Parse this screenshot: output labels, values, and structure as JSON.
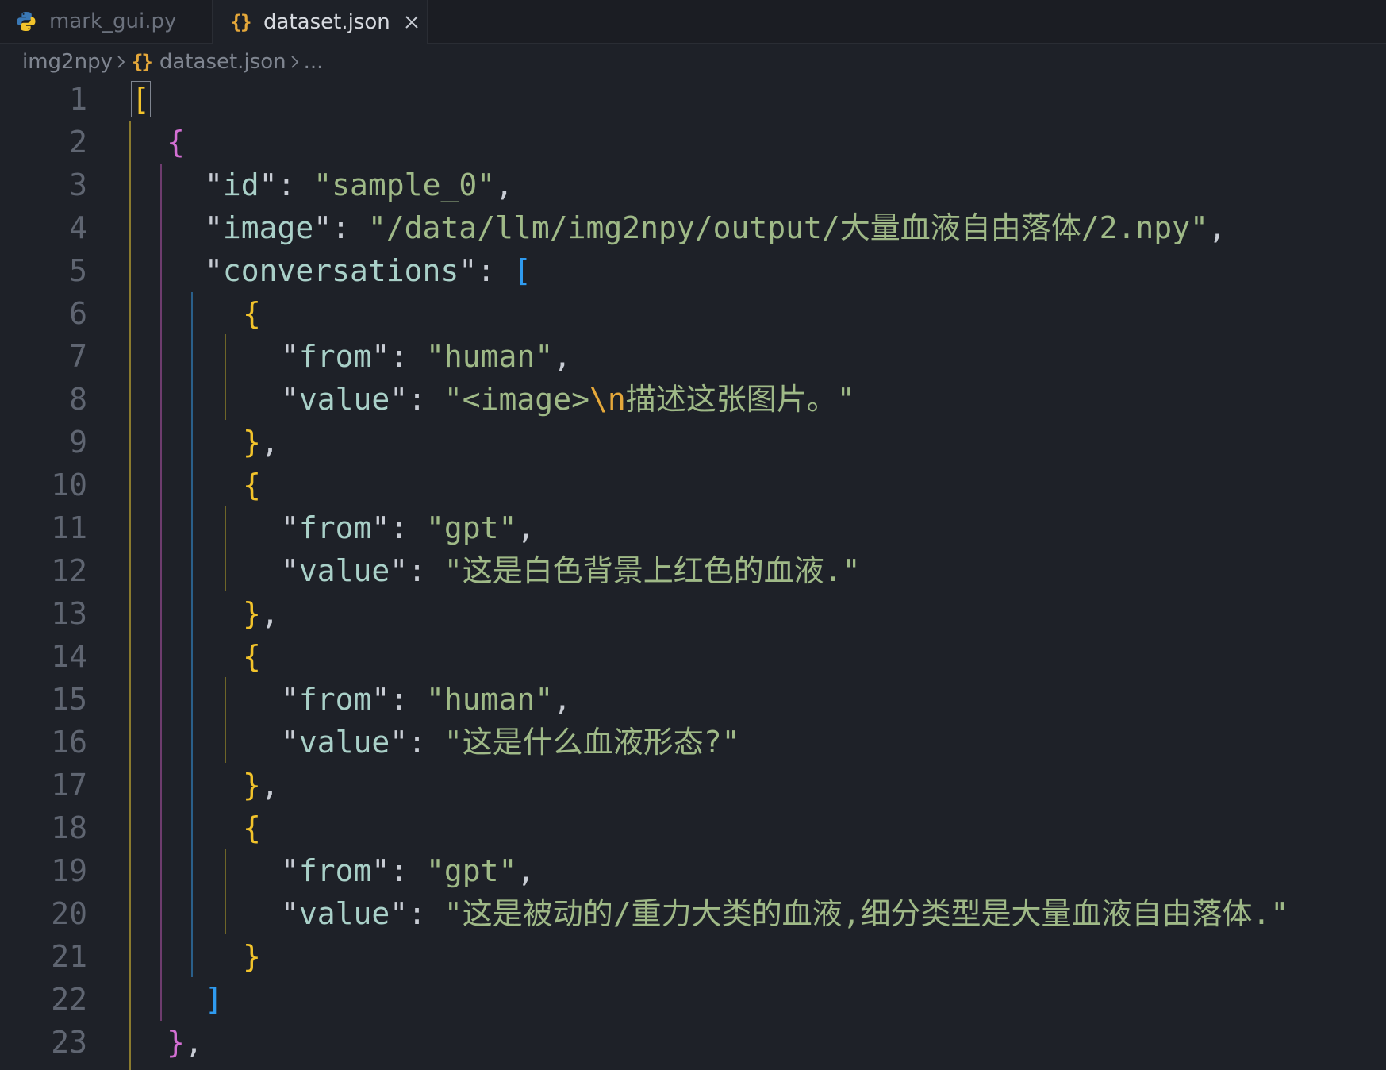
{
  "tabs": [
    {
      "label": "mark_gui.py",
      "icon": "python-file-icon",
      "active": false
    },
    {
      "label": "dataset.json",
      "icon": "json-braces-icon",
      "active": true
    }
  ],
  "breadcrumb": {
    "folder": "img2npy",
    "file": "dataset.json",
    "more": "..."
  },
  "editor": {
    "line_numbers": [
      "1",
      "2",
      "3",
      "4",
      "5",
      "6",
      "7",
      "8",
      "9",
      "10",
      "11",
      "12",
      "13",
      "14",
      "15",
      "16",
      "17",
      "18",
      "19",
      "20",
      "21",
      "22",
      "23"
    ],
    "lines": [
      [
        {
          "t": "b1",
          "v": "["
        }
      ],
      [
        {
          "t": "b2",
          "v": "{"
        }
      ],
      [
        {
          "t": "p",
          "v": "\""
        },
        {
          "t": "k",
          "v": "id"
        },
        {
          "t": "p",
          "v": "\": "
        },
        {
          "t": "s",
          "v": "\"sample_0\""
        },
        {
          "t": "p",
          "v": ","
        }
      ],
      [
        {
          "t": "p",
          "v": "\""
        },
        {
          "t": "k",
          "v": "image"
        },
        {
          "t": "p",
          "v": "\": "
        },
        {
          "t": "s",
          "v": "\"/data/llm/img2npy/output/大量血液自由落体/2.npy\""
        },
        {
          "t": "p",
          "v": ","
        }
      ],
      [
        {
          "t": "p",
          "v": "\""
        },
        {
          "t": "k",
          "v": "conversations"
        },
        {
          "t": "p",
          "v": "\": "
        },
        {
          "t": "b3",
          "v": "["
        }
      ],
      [
        {
          "t": "b1",
          "v": "{"
        }
      ],
      [
        {
          "t": "p",
          "v": "\""
        },
        {
          "t": "k",
          "v": "from"
        },
        {
          "t": "p",
          "v": "\": "
        },
        {
          "t": "s",
          "v": "\"human\""
        },
        {
          "t": "p",
          "v": ","
        }
      ],
      [
        {
          "t": "p",
          "v": "\""
        },
        {
          "t": "k",
          "v": "value"
        },
        {
          "t": "p",
          "v": "\": "
        },
        {
          "t": "s",
          "v": "\"<image>"
        },
        {
          "t": "esc",
          "v": "\\n"
        },
        {
          "t": "s",
          "v": "描述这张图片。\""
        }
      ],
      [
        {
          "t": "b1",
          "v": "}"
        },
        {
          "t": "p",
          "v": ","
        }
      ],
      [
        {
          "t": "b1",
          "v": "{"
        }
      ],
      [
        {
          "t": "p",
          "v": "\""
        },
        {
          "t": "k",
          "v": "from"
        },
        {
          "t": "p",
          "v": "\": "
        },
        {
          "t": "s",
          "v": "\"gpt\""
        },
        {
          "t": "p",
          "v": ","
        }
      ],
      [
        {
          "t": "p",
          "v": "\""
        },
        {
          "t": "k",
          "v": "value"
        },
        {
          "t": "p",
          "v": "\": "
        },
        {
          "t": "s",
          "v": "\"这是白色背景上红色的血液.\""
        }
      ],
      [
        {
          "t": "b1",
          "v": "}"
        },
        {
          "t": "p",
          "v": ","
        }
      ],
      [
        {
          "t": "b1",
          "v": "{"
        }
      ],
      [
        {
          "t": "p",
          "v": "\""
        },
        {
          "t": "k",
          "v": "from"
        },
        {
          "t": "p",
          "v": "\": "
        },
        {
          "t": "s",
          "v": "\"human\""
        },
        {
          "t": "p",
          "v": ","
        }
      ],
      [
        {
          "t": "p",
          "v": "\""
        },
        {
          "t": "k",
          "v": "value"
        },
        {
          "t": "p",
          "v": "\": "
        },
        {
          "t": "s",
          "v": "\"这是什么血液形态?\""
        }
      ],
      [
        {
          "t": "b1",
          "v": "}"
        },
        {
          "t": "p",
          "v": ","
        }
      ],
      [
        {
          "t": "b1",
          "v": "{"
        }
      ],
      [
        {
          "t": "p",
          "v": "\""
        },
        {
          "t": "k",
          "v": "from"
        },
        {
          "t": "p",
          "v": "\": "
        },
        {
          "t": "s",
          "v": "\"gpt\""
        },
        {
          "t": "p",
          "v": ","
        }
      ],
      [
        {
          "t": "p",
          "v": "\""
        },
        {
          "t": "k",
          "v": "value"
        },
        {
          "t": "p",
          "v": "\": "
        },
        {
          "t": "s",
          "v": "\"这是被动的/重力大类的血液,细分类型是大量血液自由落体.\""
        }
      ],
      [
        {
          "t": "b1",
          "v": "}"
        }
      ],
      [
        {
          "t": "b3",
          "v": "]"
        }
      ],
      [
        {
          "t": "b2",
          "v": "}"
        },
        {
          "t": "p",
          "v": ","
        }
      ]
    ]
  },
  "colors": {
    "background": "#1e2128",
    "tabbar": "#1b1d23",
    "key": "#a9d0c8",
    "string": "#9fb987",
    "escape": "#e5a83a",
    "bracket_yellow": "#f2c32b",
    "bracket_magenta": "#d36fd3",
    "bracket_blue": "#2f9bf0",
    "line_number": "#5f6571"
  }
}
